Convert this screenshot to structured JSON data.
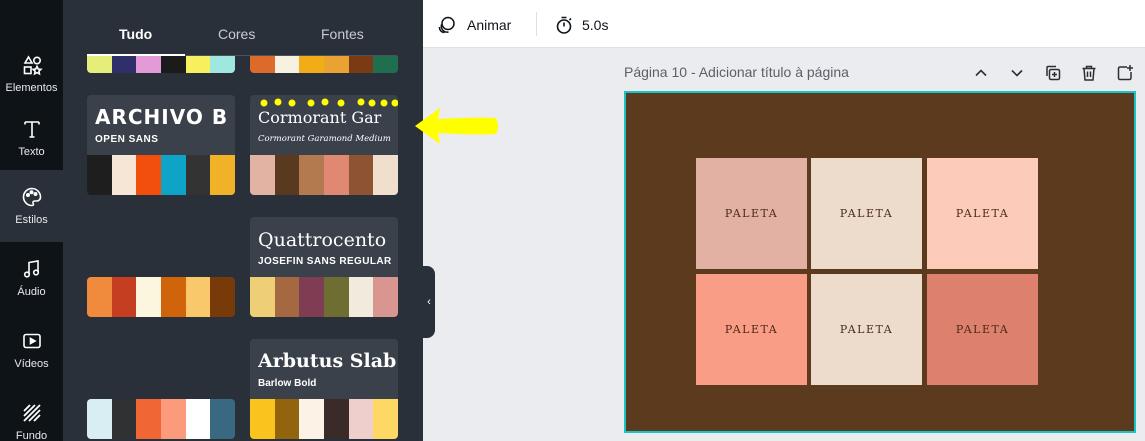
{
  "rail": {
    "items": [
      {
        "label": "Elementos",
        "icon": "shapes-icon"
      },
      {
        "label": "Texto",
        "icon": "text-icon"
      },
      {
        "label": "Estilos",
        "icon": "palette-icon"
      },
      {
        "label": "Áudio",
        "icon": "music-icon"
      },
      {
        "label": "Vídeos",
        "icon": "video-icon"
      },
      {
        "label": "Fundo",
        "icon": "background-icon"
      }
    ]
  },
  "panel": {
    "tabs": [
      "Tudo",
      "Cores",
      "Fontes"
    ],
    "top_swatches_left": [
      "#e6ee7b",
      "#2e2f6b",
      "#e59ad8",
      "#1b1b1b",
      "#f8ef5e",
      "#9fe7df"
    ],
    "top_swatches_right": [
      "#dc6a2a",
      "#f7f1e1",
      "#f2ad16",
      "#e8a333",
      "#7a3a14",
      "#1f6e4e"
    ],
    "cards": [
      {
        "title": "ARCHIVO B",
        "subtitle": "OPEN SANS",
        "colors": [
          "#1e1e1e",
          "#f6e6d6",
          "#f24e0e",
          "#0da4c7",
          "#333333",
          "#f2b227"
        ]
      },
      {
        "title": "Cormorant Gar",
        "subtitle": "Cormorant Garamond Medium",
        "colors": [
          "#e2b2a3",
          "#5a3a1e",
          "#b27a4e",
          "#e18873",
          "#8c5433",
          "#efdfcc"
        ]
      },
      {
        "title": "Quattrocento",
        "subtitle": "JOSEFIN SANS REGULAR",
        "colors": [
          "#eecf76",
          "#a56840",
          "#7e3d52",
          "#6f6e32",
          "#f2eadc",
          "#d99690"
        ]
      },
      {
        "title": "Arbutus Slab",
        "subtitle": "Barlow Bold",
        "colors": [
          "#fbc31d",
          "#93640e",
          "#fcf3e6",
          "#3a2b28",
          "#eecfcb",
          "#fdd865"
        ]
      }
    ],
    "palette_a": [
      "#f08a3c",
      "#c63e21",
      "#fbf6dd",
      "#d0640b",
      "#f8c86b",
      "#773a08"
    ],
    "palette_b": [
      "#d9eef3",
      "#2f3133",
      "#f06635",
      "#fb9b7c",
      "#ffffff",
      "#386980"
    ]
  },
  "topbar": {
    "animate_label": "Animar",
    "duration_label": "5.0s"
  },
  "page": {
    "title": "Página 10 - Adicionar título à página",
    "background": "#5b3a1d",
    "tiles": [
      {
        "label": "PALETA",
        "color": "#e2b1a3"
      },
      {
        "label": "PALETA",
        "color": "#eddccc"
      },
      {
        "label": "PALETA",
        "color": "#fdcbba"
      },
      {
        "label": "PALETA",
        "color": "#f99d86"
      },
      {
        "label": "PALETA",
        "color": "#eddccc"
      },
      {
        "label": "PALETA",
        "color": "#de806e"
      }
    ]
  },
  "colors": {
    "selection": "#19c3c6",
    "annotation_arrow": "#ffff00"
  }
}
